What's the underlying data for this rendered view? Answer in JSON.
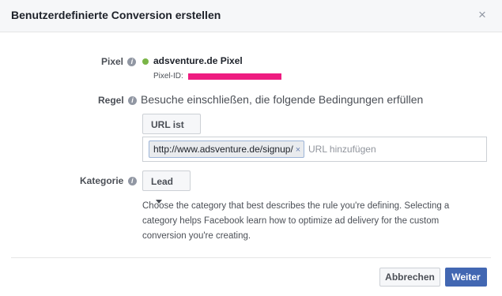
{
  "dialog": {
    "title": "Benutzerdefinierte Conversion erstellen",
    "close_glyph": "×"
  },
  "pixel": {
    "label": "Pixel",
    "info_glyph": "i",
    "status_color": "#7ab547",
    "name": "adsventure.de Pixel",
    "id_label": "Pixel-ID:"
  },
  "rule": {
    "label": "Regel",
    "info_glyph": "i",
    "description": "Besuche einschließen, die folgende Bedingungen erfüllen",
    "condition_dropdown": "URL ist",
    "url_token": "http://www.adsventure.de/signup/",
    "url_token_remove": "×",
    "url_placeholder": "URL hinzufügen"
  },
  "category": {
    "label": "Kategorie",
    "info_glyph": "i",
    "selected": "Lead",
    "help_text": "Choose the category that best describes the rule you're defining. Selecting a category helps Facebook learn how to optimize ad delivery for the custom conversion you're creating."
  },
  "footer": {
    "cancel_label": "Abbrechen",
    "next_label": "Weiter"
  },
  "colors": {
    "accent": "#4267b2",
    "redaction": "#ee1c80"
  }
}
